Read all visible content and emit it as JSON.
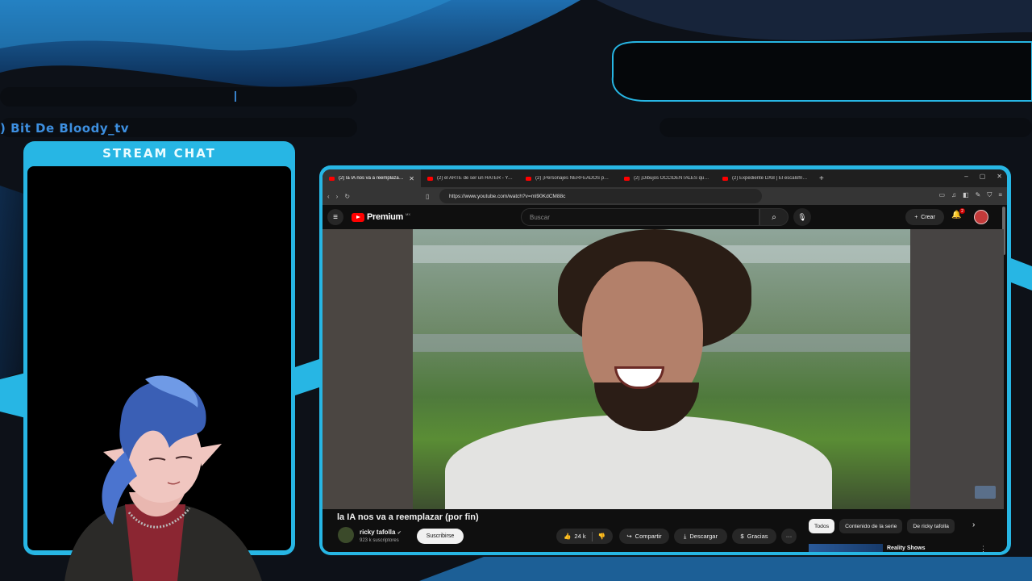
{
  "overlay": {
    "streamer_name": ") Bit De Bloody_tv",
    "chat_title": "STREAM CHAT",
    "top_bar_marker": "|",
    "accent_color": "#27b6e4"
  },
  "browser": {
    "tabs": [
      {
        "label": "(2) la IA nos va a reemplazar (…",
        "active": true
      },
      {
        "label": "(2) el ARTE de ser un HATER - YouTube",
        "active": false
      },
      {
        "label": "(2) ¡Personajes NERFEADOS por \"el b…",
        "active": false
      },
      {
        "label": "(2) ¡Dibujos OCCIDENTALES que se c…",
        "active": false
      },
      {
        "label": "(2) Expediente DXB | El escalofriante…",
        "active": false
      }
    ],
    "new_tab": "+",
    "window_controls": [
      "–",
      "▢",
      "✕"
    ],
    "url": "https://www.youtube.com/watch?v=ml90KdCM88c"
  },
  "youtube": {
    "logo_text": "Premium",
    "region": "MX",
    "search_placeholder": "Buscar",
    "create_label": "Crear",
    "notifications_count": "2",
    "video_title": "la IA nos va a reemplazar (por fin)",
    "channel_name": "ricky tafolla",
    "channel_subs": "923 k suscriptores",
    "subscribe_label": "Suscribirse",
    "likes": "24 k",
    "share_label": "Compartir",
    "download_label": "Descargar",
    "thanks_label": "Gracias",
    "more_label": "···",
    "chips": [
      "Todos",
      "Contenido de la serie",
      "De ricky tafolla"
    ],
    "rec_title": "Reality Shows"
  }
}
